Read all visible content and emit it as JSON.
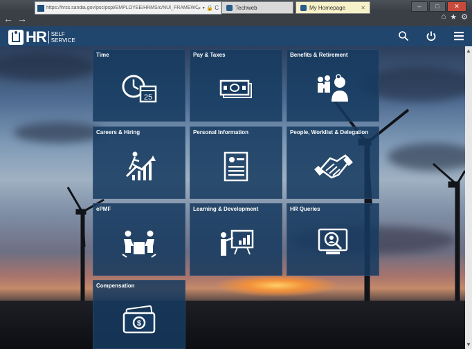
{
  "browser": {
    "address_url": "https://hrss.sandia.gov/psc/pspl/EMPLOYEE/HRMS/c/NUI_FRAMEWORK.P",
    "address_icons": "⌕ ▾ 🔒 C",
    "tabs": [
      {
        "label": "Techweb",
        "active": false
      },
      {
        "label": "My Homepage",
        "active": true
      }
    ]
  },
  "header": {
    "logo_main": "HR",
    "logo_sub_line1": "SELF",
    "logo_sub_line2": "SERVICE",
    "accent_color": "#21466e"
  },
  "tiles": [
    {
      "label": "Time",
      "icon": "clock-calendar-icon",
      "calendar_day": "25"
    },
    {
      "label": "Pay & Taxes",
      "icon": "money-bills-icon"
    },
    {
      "label": "Benefits & Retirement",
      "icon": "family-doctor-icon"
    },
    {
      "label": "Careers & Hiring",
      "icon": "career-growth-icon"
    },
    {
      "label": "Personal Information",
      "icon": "id-card-icon"
    },
    {
      "label": "People, Worklist & Delegation",
      "icon": "handshake-icon"
    },
    {
      "label": "ePMF",
      "icon": "meeting-icon"
    },
    {
      "label": "Learning & Development",
      "icon": "presentation-icon"
    },
    {
      "label": "HR Queries",
      "icon": "search-person-icon"
    },
    {
      "label": "Compensation",
      "icon": "cash-icon"
    }
  ]
}
